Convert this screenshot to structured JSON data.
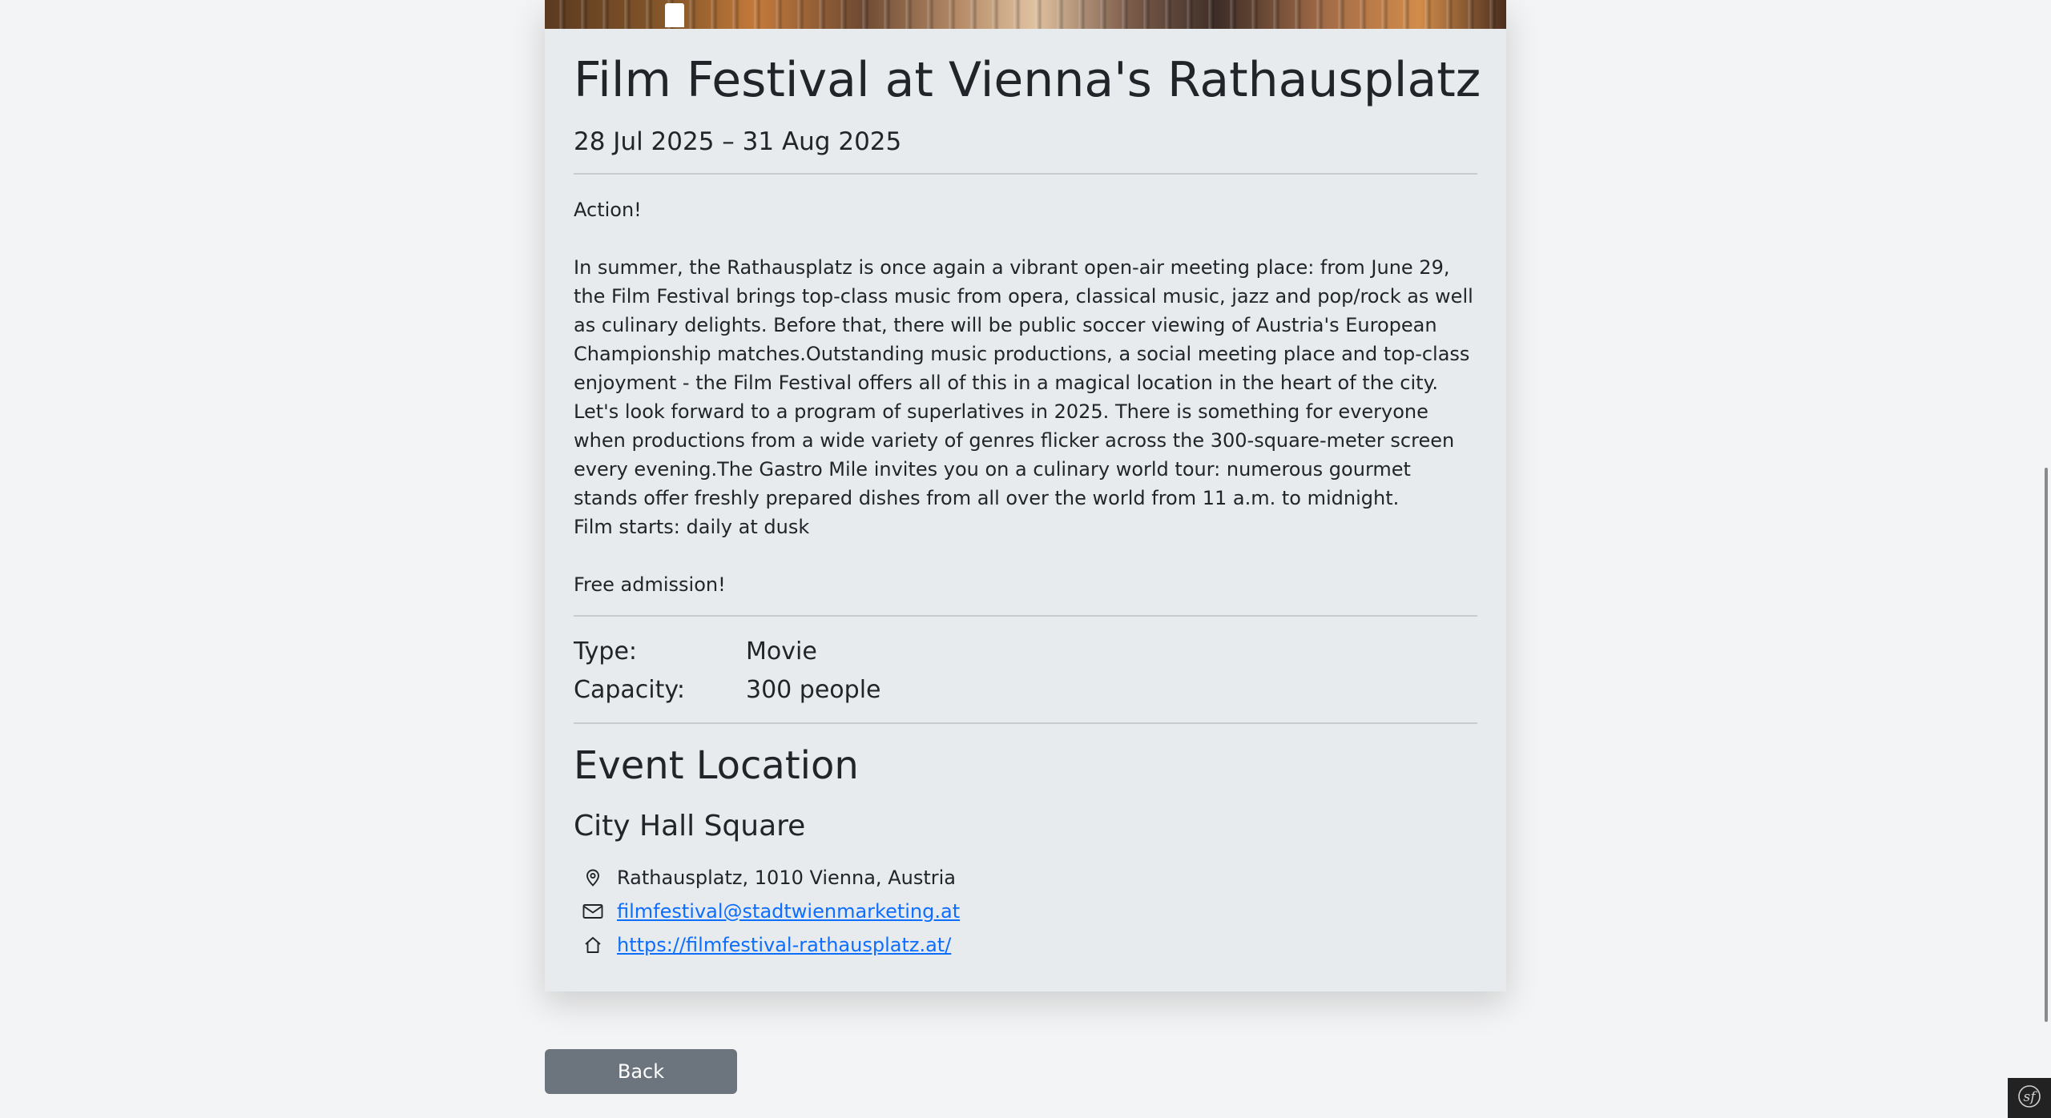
{
  "event": {
    "title": "Film Festival at Vienna's Rathausplatz",
    "dates": "28 Jul 2025 – 31 Aug 2025",
    "description": [
      "Action!",
      "In summer, the Rathausplatz is once again a vibrant open-air meeting place: from June 29, the Film Festival brings top-class music from opera, classical music, jazz and pop/rock as well as culinary delights. Before that, there will be public soccer viewing of Austria's European Championship matches.Outstanding music productions, a social meeting place and top-class enjoyment - the Film Festival offers all of this in a magical location in the heart of the city. Let's look forward to a program of superlatives in 2025. There is something for everyone when productions from a wide variety of genres flicker across the 300-square-meter screen every evening.The Gastro Mile invites you on a culinary world tour: numerous gourmet stands offer freshly prepared dishes from all over the world from 11 a.m. to midnight.",
      "Film starts: daily at dusk",
      "Free admission!"
    ],
    "details": {
      "type_label": "Type:",
      "type_value": "Movie",
      "capacity_label": "Capacity:",
      "capacity_value": "300 people"
    }
  },
  "location": {
    "heading": "Event Location",
    "name": "City Hall Square",
    "address": "Rathausplatz, 1010 Vienna, Austria",
    "email": "filmfestival@stadtwienmarketing.at",
    "website": "https://filmfestival-rathausplatz.at/",
    "icons": {
      "address": "map-pin-icon",
      "email": "envelope-icon",
      "website": "house-icon"
    }
  },
  "actions": {
    "back_label": "Back"
  },
  "colors": {
    "page_background": "#f3f4f5",
    "card_background": "#e8ebee",
    "link": "#0d6efd",
    "back_button": "#6c757d",
    "debug_toolbar": "#222222"
  },
  "debug_toolbar": {
    "icon": "symfony-logo-icon"
  }
}
